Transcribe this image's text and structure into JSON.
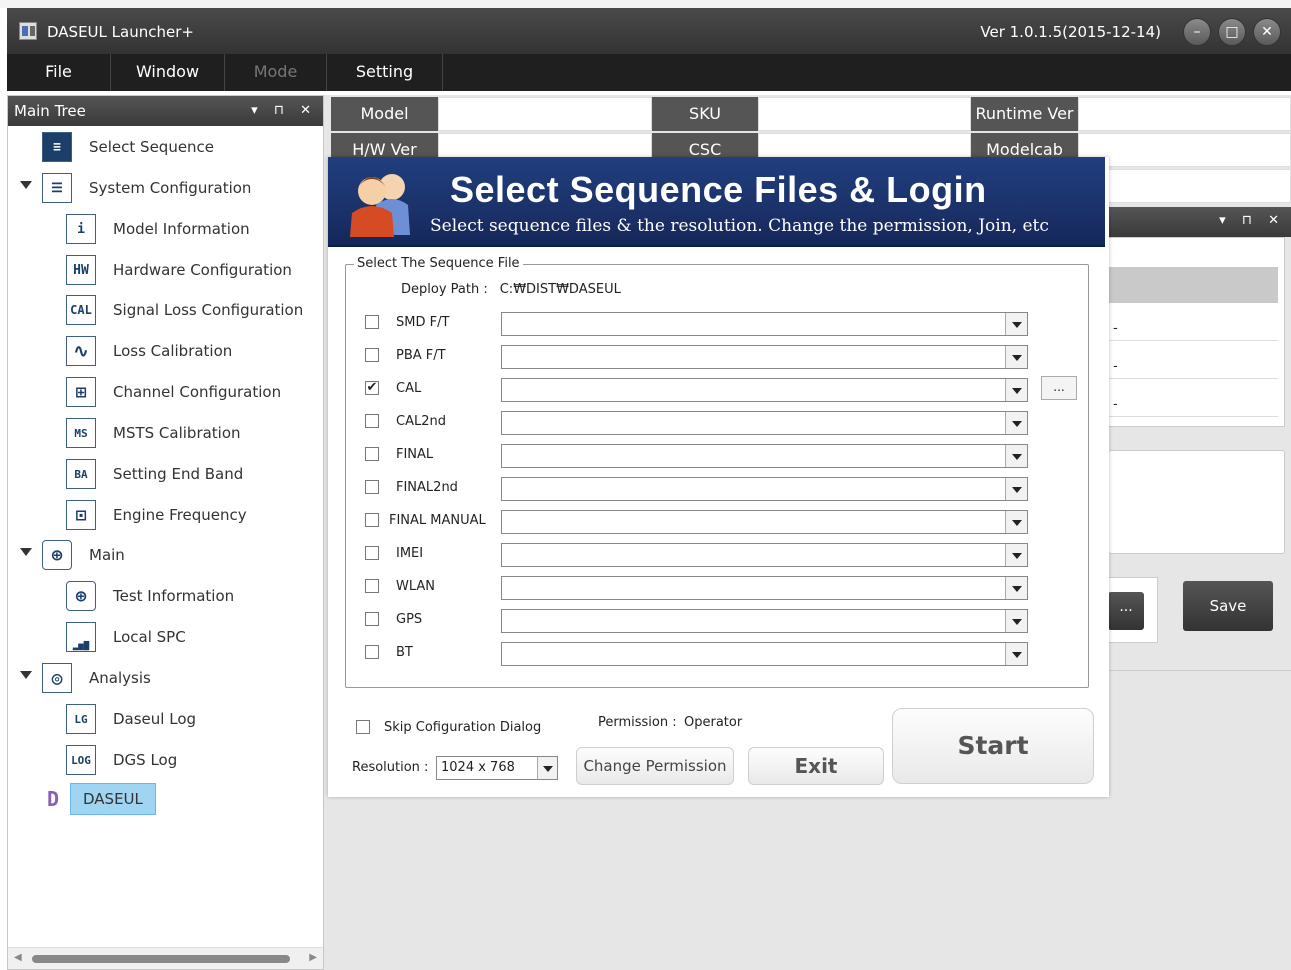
{
  "app": {
    "title": "DASEUL Launcher+",
    "version": "Ver 1.0.1.5(2015-12-14)"
  },
  "window_controls": {
    "minimize": "–",
    "maximize": "□",
    "close": "✕"
  },
  "menu": {
    "file": "File",
    "window": "Window",
    "mode": "Mode",
    "setting": "Setting"
  },
  "left_panel": {
    "title": "Main Tree",
    "controls": "▾ ⊓ ✕",
    "items": [
      {
        "label": "Select Sequence",
        "icon": "sequence-list-icon"
      },
      {
        "label": "System Configuration",
        "icon": "system-config-icon"
      },
      {
        "label": "Model Information",
        "icon": "info-icon",
        "glyph": "i"
      },
      {
        "label": "Hardware Configuration",
        "icon": "hw-icon",
        "glyph": "HW"
      },
      {
        "label": "Signal Loss Configuration",
        "icon": "cal-icon",
        "glyph": "CAL"
      },
      {
        "label": "Loss Calibration",
        "icon": "waveform-icon",
        "glyph": "∿"
      },
      {
        "label": "Channel Configuration",
        "icon": "channel-icon",
        "glyph": "⊞"
      },
      {
        "label": "MSTS Calibration",
        "icon": "msts-icon",
        "glyph": "MS"
      },
      {
        "label": "Setting End Band",
        "icon": "band-icon",
        "glyph": "BA"
      },
      {
        "label": "Engine Frequency",
        "icon": "frequency-icon",
        "glyph": "⊡"
      },
      {
        "label": "Main",
        "icon": "main-icon",
        "glyph": "⊕"
      },
      {
        "label": "Test Information",
        "icon": "test-info-icon",
        "glyph": "⊕"
      },
      {
        "label": "Local SPC",
        "icon": "spc-chart-icon",
        "glyph": "▂▅▇"
      },
      {
        "label": "Analysis",
        "icon": "analysis-icon",
        "glyph": "◎"
      },
      {
        "label": "Daseul Log",
        "icon": "daseul-log-icon",
        "glyph": "LG"
      },
      {
        "label": "DGS Log",
        "icon": "dgs-log-icon",
        "glyph": "LOG"
      },
      {
        "label": "DASEUL",
        "icon": "daseul-icon",
        "glyph": "D"
      }
    ]
  },
  "info_table": {
    "model": "Model",
    "sku": "SKU",
    "runtime_ver": "Runtime Ver",
    "hw_ver": "H/W Ver",
    "csc": "CSC",
    "modelcab_ver": "Modelcab Ver"
  },
  "right_panel": {
    "controls": "▾ ⊓ ✕",
    "dashes": [
      "-",
      "-",
      "-"
    ],
    "small_button": "...",
    "save": "Save"
  },
  "dialog": {
    "title": "Select Sequence Files & Login",
    "subtitle": "Select sequence files & the resolution. Change the permission, Join, etc",
    "group_title": "Select The Sequence File",
    "deploy_label": "Deploy Path :",
    "deploy_value": "C:₩DIST₩DASEUL",
    "sequences": [
      {
        "label": "SMD F/T",
        "checked": false
      },
      {
        "label": "PBA F/T",
        "checked": false
      },
      {
        "label": "CAL",
        "checked": true
      },
      {
        "label": "CAL2nd",
        "checked": false
      },
      {
        "label": "FINAL",
        "checked": false
      },
      {
        "label": "FINAL2nd",
        "checked": false
      },
      {
        "label": "FINAL MANUAL",
        "checked": false
      },
      {
        "label": "IMEI",
        "checked": false
      },
      {
        "label": "WLAN",
        "checked": false
      },
      {
        "label": "GPS",
        "checked": false
      },
      {
        "label": "BT",
        "checked": false
      }
    ],
    "browse_label": "...",
    "skip_label": "Skip Cofiguration Dialog",
    "permission_label": "Permission :",
    "permission_value": "Operator",
    "resolution_label": "Resolution :",
    "resolution_value": "1024 x 768",
    "change_permission": "Change Permission",
    "exit": "Exit",
    "start": "Start",
    "check_mark": "✔"
  }
}
